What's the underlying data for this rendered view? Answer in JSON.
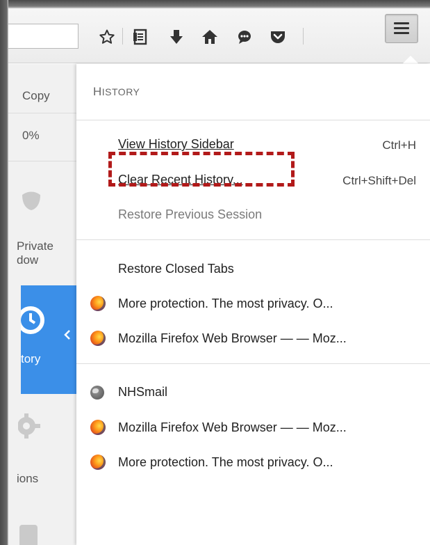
{
  "toolbar": {
    "icons": [
      "star-icon",
      "reading-list-icon",
      "download-icon",
      "home-icon",
      "chat-icon",
      "pocket-icon",
      "menu-icon"
    ]
  },
  "main_panel": {
    "items": [
      {
        "label": "Copy"
      },
      {
        "label": "0%"
      },
      {
        "label": "Private\ndow"
      },
      {
        "label": "tory"
      },
      {
        "label": "ions"
      }
    ]
  },
  "history_panel": {
    "title_first": "H",
    "title_rest": "ISTORY",
    "view_sidebar": {
      "label": "View History Sidebar",
      "shortcut": "Ctrl+H"
    },
    "clear_recent": {
      "label": "Clear Recent History...",
      "shortcut": "Ctrl+Shift+Del"
    },
    "restore_session": {
      "label": "Restore Previous Session"
    },
    "restore_tabs": {
      "label": "Restore Closed Tabs"
    },
    "closed_tabs": [
      "More protection. The most privacy. O...",
      "Mozilla Firefox Web Browser — — Moz..."
    ],
    "recent": [
      {
        "icon": "globe",
        "label": "NHSmail"
      },
      {
        "icon": "firefox",
        "label": "Mozilla Firefox Web Browser — — Moz..."
      },
      {
        "icon": "firefox",
        "label": "More protection. The most privacy. O..."
      }
    ]
  },
  "colors": {
    "highlight": "#b21a1a",
    "history_active": "#3b8fe8"
  }
}
